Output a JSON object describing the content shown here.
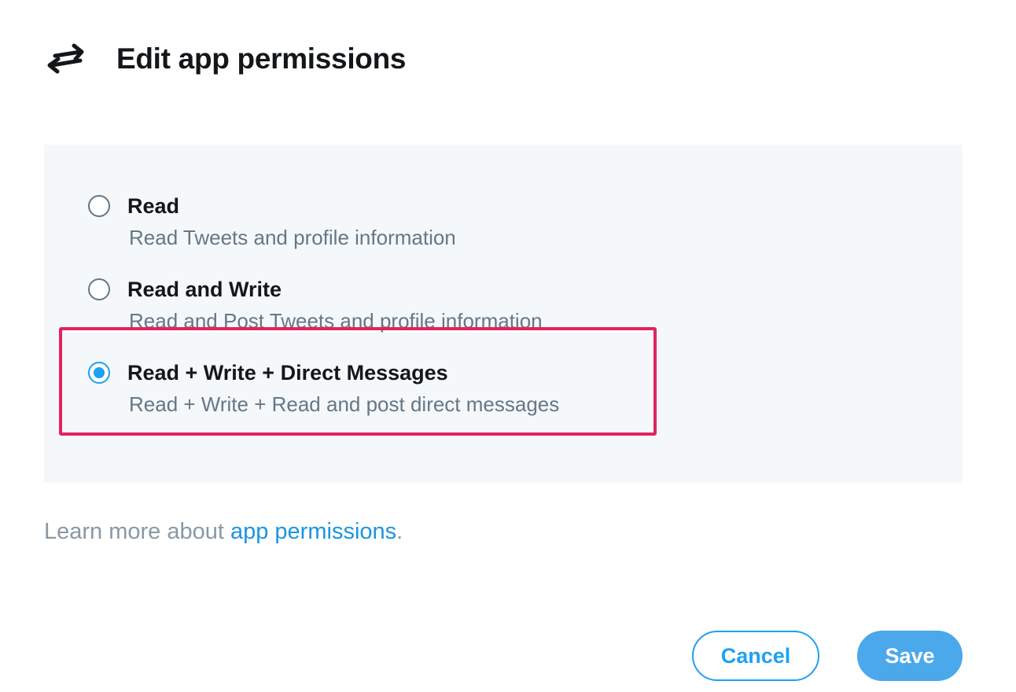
{
  "header": {
    "icon": "swap-arrows-icon",
    "title": "Edit app permissions"
  },
  "permissions": {
    "selected_index": 2,
    "options": [
      {
        "label": "Read",
        "description": "Read Tweets and profile information"
      },
      {
        "label": "Read and Write",
        "description": "Read and Post Tweets and profile information"
      },
      {
        "label": "Read + Write + Direct Messages",
        "description": "Read + Write + Read and post direct messages"
      }
    ]
  },
  "learn_more": {
    "prefix": "Learn more about ",
    "link_text": "app permissions",
    "suffix": "."
  },
  "actions": {
    "cancel_label": "Cancel",
    "save_label": "Save"
  },
  "colors": {
    "accent": "#1da1f2",
    "save_button": "#4ba8ea",
    "highlight_border": "#e0245e",
    "panel_background": "#f5f8fa",
    "title_text": "#14171a",
    "secondary_text": "#657786"
  }
}
